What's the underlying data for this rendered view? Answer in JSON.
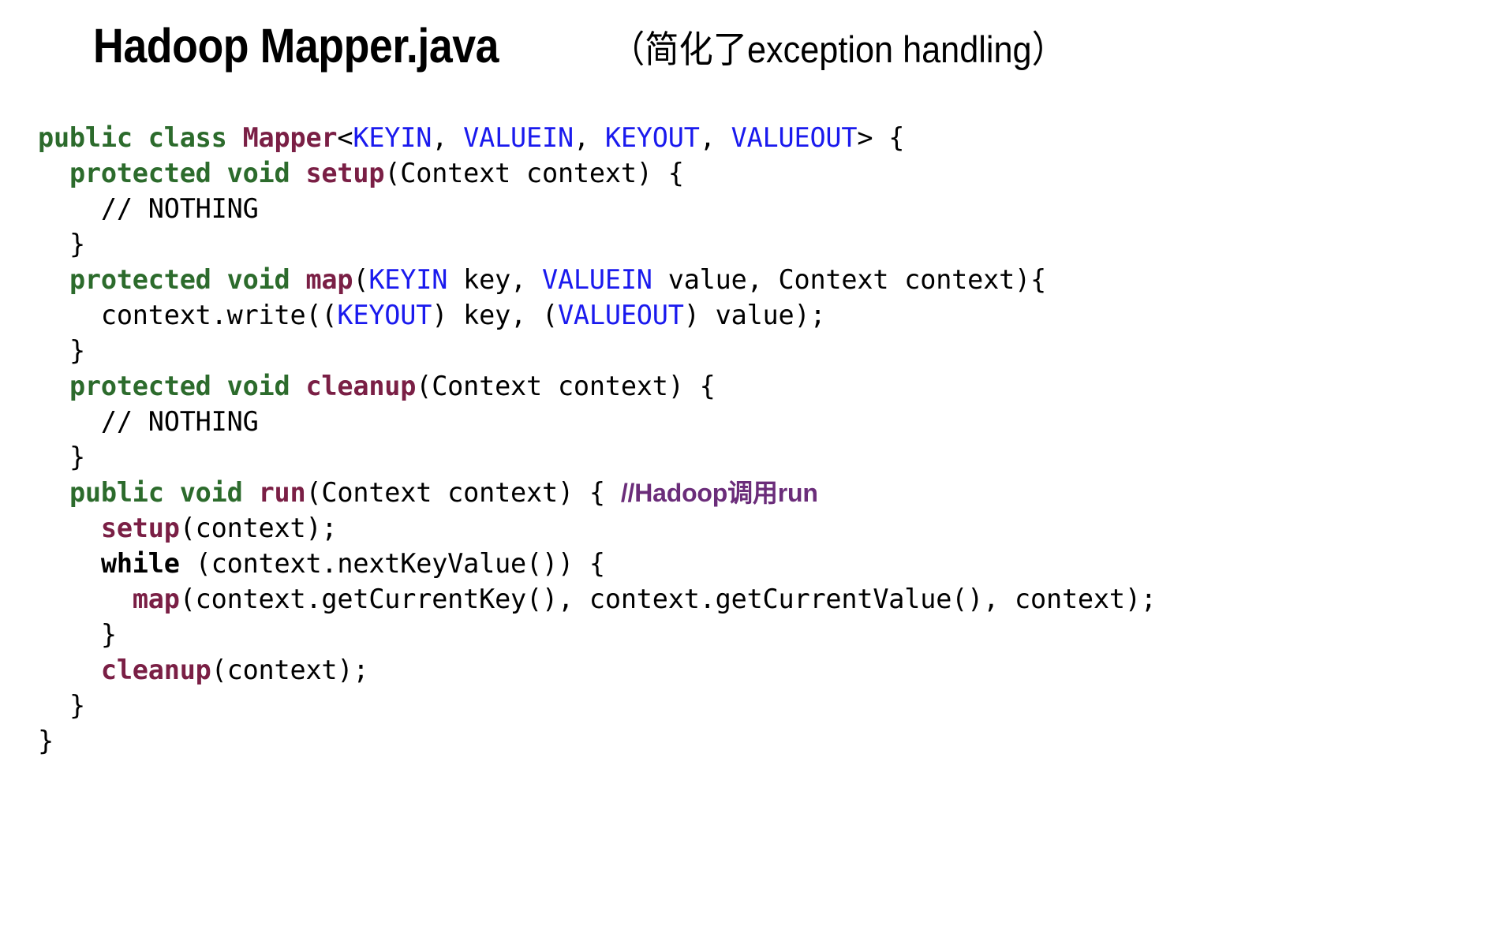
{
  "slide": {
    "background_color": "#ffffff",
    "title": {
      "main": "Hadoop Mapper.java",
      "note": "（简化了exception handling）"
    }
  },
  "colors": {
    "keyword_green": "#2c6b2c",
    "identifier_maroon": "#7a1f45",
    "generic_blue": "#1a1aee",
    "comment_purple": "#6b2d7a",
    "plain_black": "#000000"
  },
  "code": {
    "language": "java",
    "lines": [
      {
        "indent": 0,
        "tokens": [
          {
            "t": "public",
            "c": "kw"
          },
          {
            "t": " ",
            "c": "plain"
          },
          {
            "t": "class",
            "c": "kw"
          },
          {
            "t": " ",
            "c": "plain"
          },
          {
            "t": "Mapper",
            "c": "name"
          },
          {
            "t": "<",
            "c": "plain"
          },
          {
            "t": "KEYIN",
            "c": "gen"
          },
          {
            "t": ", ",
            "c": "plain"
          },
          {
            "t": "VALUEIN",
            "c": "gen"
          },
          {
            "t": ", ",
            "c": "plain"
          },
          {
            "t": "KEYOUT",
            "c": "gen"
          },
          {
            "t": ", ",
            "c": "plain"
          },
          {
            "t": "VALUEOUT",
            "c": "gen"
          },
          {
            "t": "> {",
            "c": "plain"
          }
        ]
      },
      {
        "indent": 1,
        "tokens": [
          {
            "t": "protected",
            "c": "kw"
          },
          {
            "t": " ",
            "c": "plain"
          },
          {
            "t": "void",
            "c": "kw"
          },
          {
            "t": " ",
            "c": "plain"
          },
          {
            "t": "setup",
            "c": "name"
          },
          {
            "t": "(Context context) {",
            "c": "plain"
          }
        ]
      },
      {
        "indent": 2,
        "tokens": [
          {
            "t": "// NOTHING",
            "c": "cmt"
          }
        ]
      },
      {
        "indent": 1,
        "tokens": [
          {
            "t": "}",
            "c": "plain"
          }
        ]
      },
      {
        "indent": 1,
        "tokens": [
          {
            "t": "protected",
            "c": "kw"
          },
          {
            "t": " ",
            "c": "plain"
          },
          {
            "t": "void",
            "c": "kw"
          },
          {
            "t": " ",
            "c": "plain"
          },
          {
            "t": "map",
            "c": "name"
          },
          {
            "t": "(",
            "c": "plain"
          },
          {
            "t": "KEYIN",
            "c": "gen"
          },
          {
            "t": " key, ",
            "c": "plain"
          },
          {
            "t": "VALUEIN",
            "c": "gen"
          },
          {
            "t": " value, Context context){",
            "c": "plain"
          }
        ]
      },
      {
        "indent": 2,
        "tokens": [
          {
            "t": "context.write((",
            "c": "plain"
          },
          {
            "t": "KEYOUT",
            "c": "gen"
          },
          {
            "t": ") key, (",
            "c": "plain"
          },
          {
            "t": "VALUEOUT",
            "c": "gen"
          },
          {
            "t": ") value);",
            "c": "plain"
          }
        ]
      },
      {
        "indent": 1,
        "tokens": [
          {
            "t": "}",
            "c": "plain"
          }
        ]
      },
      {
        "indent": 1,
        "tokens": [
          {
            "t": "protected",
            "c": "kw"
          },
          {
            "t": " ",
            "c": "plain"
          },
          {
            "t": "void",
            "c": "kw"
          },
          {
            "t": " ",
            "c": "plain"
          },
          {
            "t": "cleanup",
            "c": "name"
          },
          {
            "t": "(Context context) {",
            "c": "plain"
          }
        ]
      },
      {
        "indent": 2,
        "tokens": [
          {
            "t": "// NOTHING",
            "c": "cmt"
          }
        ]
      },
      {
        "indent": 1,
        "tokens": [
          {
            "t": "}",
            "c": "plain"
          }
        ]
      },
      {
        "indent": 1,
        "tokens": [
          {
            "t": "public",
            "c": "kw"
          },
          {
            "t": " ",
            "c": "plain"
          },
          {
            "t": "void",
            "c": "kw"
          },
          {
            "t": " ",
            "c": "plain"
          },
          {
            "t": "run",
            "c": "name"
          },
          {
            "t": "(Context context) { ",
            "c": "plain"
          },
          {
            "t": "//Hadoop调用run",
            "c": "cmt-cn"
          }
        ]
      },
      {
        "indent": 2,
        "tokens": [
          {
            "t": "setup",
            "c": "name"
          },
          {
            "t": "(context);",
            "c": "plain"
          }
        ]
      },
      {
        "indent": 2,
        "tokens": [
          {
            "t": "while",
            "c": "bold"
          },
          {
            "t": " (context.nextKeyValue()) {",
            "c": "plain"
          }
        ]
      },
      {
        "indent": 3,
        "tokens": [
          {
            "t": "map",
            "c": "name"
          },
          {
            "t": "(context.getCurrentKey(), context.getCurrentValue(), context);",
            "c": "plain"
          }
        ]
      },
      {
        "indent": 2,
        "tokens": [
          {
            "t": "}",
            "c": "plain"
          }
        ]
      },
      {
        "indent": 2,
        "tokens": [
          {
            "t": "cleanup",
            "c": "name"
          },
          {
            "t": "(context);",
            "c": "plain"
          }
        ]
      },
      {
        "indent": 1,
        "tokens": [
          {
            "t": "}",
            "c": "plain"
          }
        ]
      },
      {
        "indent": 0,
        "tokens": [
          {
            "t": "}",
            "c": "plain"
          }
        ]
      }
    ]
  }
}
